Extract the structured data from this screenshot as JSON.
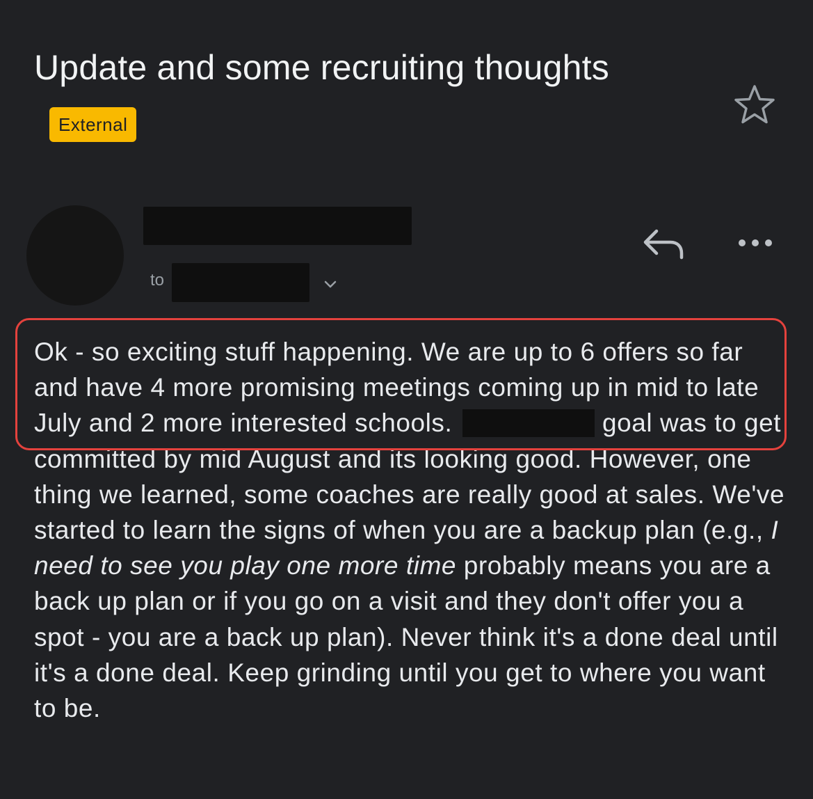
{
  "email": {
    "subject": "Update and some recruiting thoughts",
    "label": "External",
    "to_label": "to",
    "body": {
      "p1": "Ok - so exciting stuff happening.  We are up to 6 offers so far and have 4 more promising meetings coming up in mid to late July and 2 more interested schools.",
      "p2": "goal was to get committed by mid August and its looking good.  However, one thing we learned, some coaches are really good at sales.  We've started to learn the signs of when you are a backup plan (e.g.,",
      "italic": "I need to see you play one more time",
      "p3": "probably means you are a back up plan or if you go on a visit and they don't offer you a spot - you are a back up plan).  Never think it's a done deal until it's a done deal.  Keep grinding until you get to where you want to be."
    }
  },
  "icons": {
    "star": "star-outline-icon",
    "reply": "reply-icon",
    "more": "more-horizontal-icon",
    "expand": "chevron-down-icon"
  },
  "colors": {
    "background": "#202124",
    "badge": "#f9b900",
    "highlight": "#e4423d"
  }
}
